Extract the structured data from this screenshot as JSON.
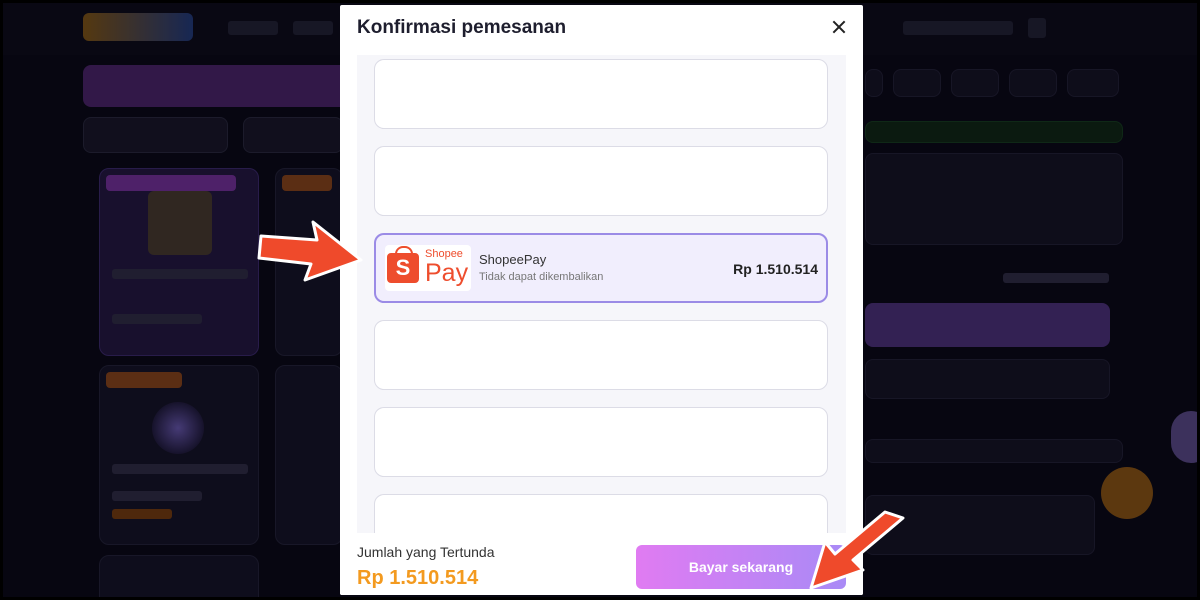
{
  "modal": {
    "title": "Konfirmasi pemesanan",
    "payment_options": [
      {
        "empty": true
      },
      {
        "empty": true
      },
      {
        "selected": true,
        "logo": {
          "shopee_text": "Shopee",
          "pay_text": "Pay",
          "icon_letter": "S"
        },
        "name": "ShopeePay",
        "note": "Tidak dapat dikembalikan",
        "amount": "Rp 1.510.514"
      },
      {
        "empty": true
      },
      {
        "empty": true
      },
      {
        "empty": true
      }
    ],
    "footer": {
      "pending_label": "Jumlah yang Tertunda",
      "pending_amount": "Rp 1.510.514",
      "pay_button": "Bayar sekarang"
    }
  },
  "colors": {
    "accent_orange": "#f39a1f",
    "shopee_orange": "#ee4d2d",
    "selected_border": "#9b8be6",
    "button_gradient_start": "#e07bf2",
    "button_gradient_end": "#a98af6",
    "annotation_arrow": "#ef4a2b"
  },
  "annotations": [
    "arrow-to-shopeepay",
    "arrow-to-pay-button"
  ]
}
